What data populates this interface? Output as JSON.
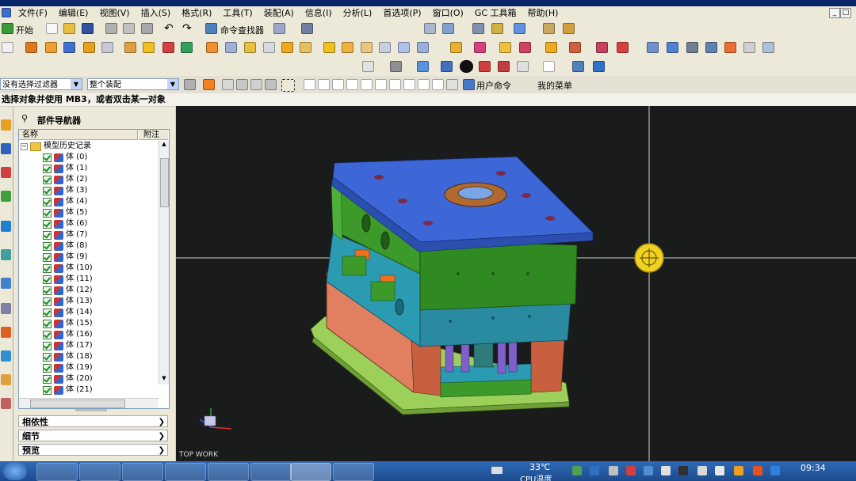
{
  "menu": {
    "items": [
      "文件(F)",
      "编辑(E)",
      "视图(V)",
      "插入(S)",
      "格式(R)",
      "工具(T)",
      "装配(A)",
      "信息(I)",
      "分析(L)",
      "首选项(P)",
      "窗口(O)",
      "GC 工具箱",
      "帮助(H)"
    ]
  },
  "toolbar": {
    "start_label": "开始",
    "command_finder_label": "命令查找器",
    "filter_value": "没有选择过滤器",
    "assembly_scope_value": "整个装配",
    "user_command_label": "用户命令",
    "my_menu_label": "我的菜单"
  },
  "status": {
    "prompt": "选择对象并使用 MB3，或者双击某一对象"
  },
  "navigator": {
    "title": "部件导航器",
    "col_name": "名称",
    "col_note": "附注",
    "root_label": "模型历史记录",
    "items": [
      "体 (0)",
      "体 (1)",
      "体 (2)",
      "体 (3)",
      "体 (4)",
      "体 (5)",
      "体 (6)",
      "体 (7)",
      "体 (8)",
      "体 (9)",
      "体 (10)",
      "体 (11)",
      "体 (12)",
      "体 (13)",
      "体 (14)",
      "体 (15)",
      "体 (16)",
      "体 (17)",
      "体 (18)",
      "体 (19)",
      "体 (20)",
      "体 (21)"
    ],
    "panels": [
      "相依性",
      "细节",
      "预览"
    ]
  },
  "viewport": {
    "view_name": "TOP WORK"
  },
  "tray": {
    "temperature": "33℃",
    "cpu_label": "CPU温度",
    "time": "09:34"
  },
  "colors": {
    "viewport_bg": "#1a1b1b",
    "plate_blue": "#3d67d6",
    "plate_green": "#3c9a2a",
    "plate_cyan": "#2a9bb0",
    "plate_salmon": "#e08060",
    "base_lime": "#9cd05a",
    "pin_purple": "#8060c8"
  }
}
